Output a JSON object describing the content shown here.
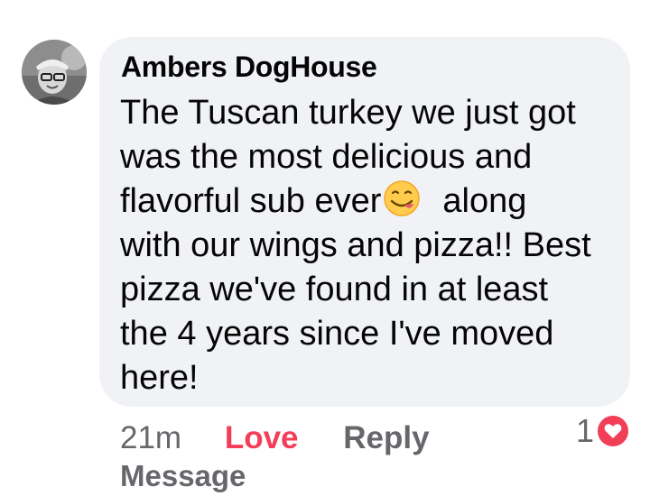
{
  "comment": {
    "author": "Ambers DogHouse",
    "text_lines": [
      "The Tuscan turkey we just got",
      "was the most delicious and",
      "flavorful sub ever",
      "along",
      "with our wings and pizza!! Best",
      "pizza we've found in at least",
      "the 4 years since I've moved",
      "here!"
    ],
    "emoji": "face-savoring-food-emoji"
  },
  "actions": {
    "time": "21m",
    "love_label": "Love",
    "reply_label": "Reply",
    "message_label": "Message"
  },
  "reactions": {
    "count": "1",
    "type": "heart-icon"
  },
  "colors": {
    "bubble": "#f0f2f5",
    "text": "#050505",
    "secondary": "#65676b",
    "love": "#f33e58"
  }
}
